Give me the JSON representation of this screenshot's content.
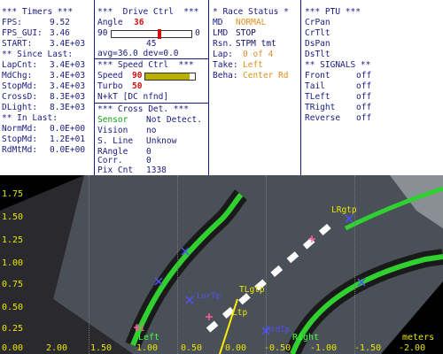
{
  "timers": {
    "header": "*** Timers ***",
    "fps_label": "FPS:",
    "fps": "9.52",
    "fpsgui_label": "FPS_GUI:",
    "fpsgui": "3.46",
    "start_label": "START:",
    "start": "3.4E+03",
    "since_header": "** Since Last:",
    "lapcnt_label": "LapCnt:",
    "lapcnt": "3.4E+03",
    "mdchg_label": "MdChg:",
    "mdchg": "3.4E+03",
    "stopmd_label": "StopMd:",
    "stopmd": "3.4E+03",
    "crossd_label": "CrossD:",
    "crossd": "8.3E+03",
    "dlight_label": "DLight:",
    "dlight": "8.3E+03",
    "inlast_header": "** In Last:",
    "normmd_label": "NormMd:",
    "normmd": "0.0E+00",
    "stopmd2_label": "StopMd:",
    "stopmd2": "1.2E+01",
    "rdmtmd_label": "RdMtMd:",
    "rdmtmd": "0.0E+00"
  },
  "drive": {
    "header": "***  Drive Ctrl  ***",
    "angle_label": "Angle",
    "angle": "36",
    "min": "90",
    "max": "0",
    "mid": "45",
    "avg": "avg=36.0 dev=0.0",
    "angle_fraction": 0.6,
    "speed_header": "*** Speed Ctrl  ***",
    "speed_label": "Speed",
    "speed": "90",
    "speed_fraction": 0.9,
    "turbo_label": "Turbo",
    "turbo": "50",
    "cross_header": "*** Cross Det. ***",
    "sensor_label": "Sensor",
    "sensor": "Not Detect.",
    "vision_label": "Vision",
    "vision": "no",
    "sline_label": "S. Line",
    "sline": "Unknow",
    "rangle_label": "RAngle",
    "rangle": "0",
    "corr_label": "Corr.",
    "corr": "0",
    "pixcnt_label": "Pix Cnt",
    "pixcnt": "1338",
    "nkt": "N+kT [DC nfnd]"
  },
  "race": {
    "header": "* Race Status *",
    "md_label": "MD",
    "md": "NORMAL",
    "lmd_label": "LMD",
    "lmd": "STOP",
    "rsn_label": "Rsn.",
    "rsn": "STPM tmt",
    "lap_label": "Lap:",
    "lap": "0 of 4",
    "take_label": "Take:",
    "take": "Left",
    "beha_label": "Beha:",
    "beha": "Center Rd"
  },
  "ptu": {
    "header": "*** PTU ***",
    "items": [
      "CrPan",
      "CrTlt",
      "DsPan",
      "DsTlt"
    ],
    "signals_header": "** SIGNALS **",
    "signals": [
      {
        "name": "Front",
        "value": "off"
      },
      {
        "name": "Tail",
        "value": "off"
      },
      {
        "name": "TLeft",
        "value": "off"
      },
      {
        "name": "TRight",
        "value": "off"
      },
      {
        "name": "Reverse",
        "value": "off"
      }
    ]
  },
  "view": {
    "y_ticks": [
      "1.75",
      "1.50",
      "1.25",
      "1.00",
      "0.75",
      "0.50",
      "0.25",
      "0.00"
    ],
    "x_ticks": [
      "2.00",
      "1.50",
      "1.00",
      "0.50",
      "0.00",
      "-0.50",
      "-1.00",
      "-1.50",
      "-2.00"
    ],
    "x_unit": "meters",
    "labels": {
      "rgtp": "LRgtp",
      "tlgtp": "TLgtp",
      "ltp": "Ltp",
      "left_g": "Left",
      "right_g": "Right",
      "lr": "L1",
      "lnt": "LnrTp",
      "rpt": "RrdTp"
    }
  }
}
